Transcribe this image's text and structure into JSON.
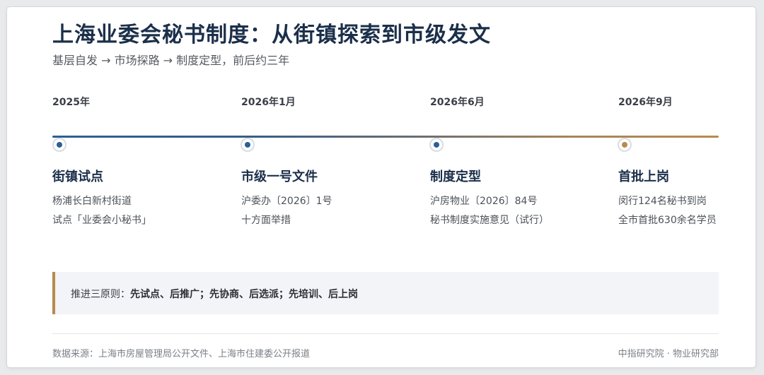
{
  "header": {
    "title": "上海业委会秘书制度：从街镇探索到市级发文",
    "subtitle": "基层自发 → 市场探路 → 制度定型，前后约三年"
  },
  "timeline": {
    "line_colors": [
      "#2c5f97",
      "#b88a4e"
    ],
    "milestones": [
      {
        "date": "2025年",
        "title": "街镇试点",
        "line1": "杨浦长白新村街道",
        "line2": "试点「业委会小秘书」",
        "dot_color": "#2c5f97"
      },
      {
        "date": "2026年1月",
        "title": "市级一号文件",
        "line1": "沪委办〔2026〕1号",
        "line2": "十方面举措",
        "dot_color": "#2c5f97"
      },
      {
        "date": "2026年6月",
        "title": "制度定型",
        "line1": "沪房物业〔2026〕84号",
        "line2": "秘书制度实施意见（试行）",
        "dot_color": "#2c5f97"
      },
      {
        "date": "2026年9月",
        "title": "首批上岗",
        "line1": "闵行124名秘书到岗",
        "line2": "全市首批630余名学员",
        "dot_color": "#b88a4e"
      }
    ]
  },
  "principles": {
    "label": "推进三原则：",
    "text": "先试点、后推广；先协商、后选派；先培训、后上岗",
    "accent": "#b88a4e"
  },
  "footer": {
    "source": "数据来源：上海市房屋管理局公开文件、上海市住建委公开报道",
    "org": "中指研究院 · 物业研究部"
  }
}
